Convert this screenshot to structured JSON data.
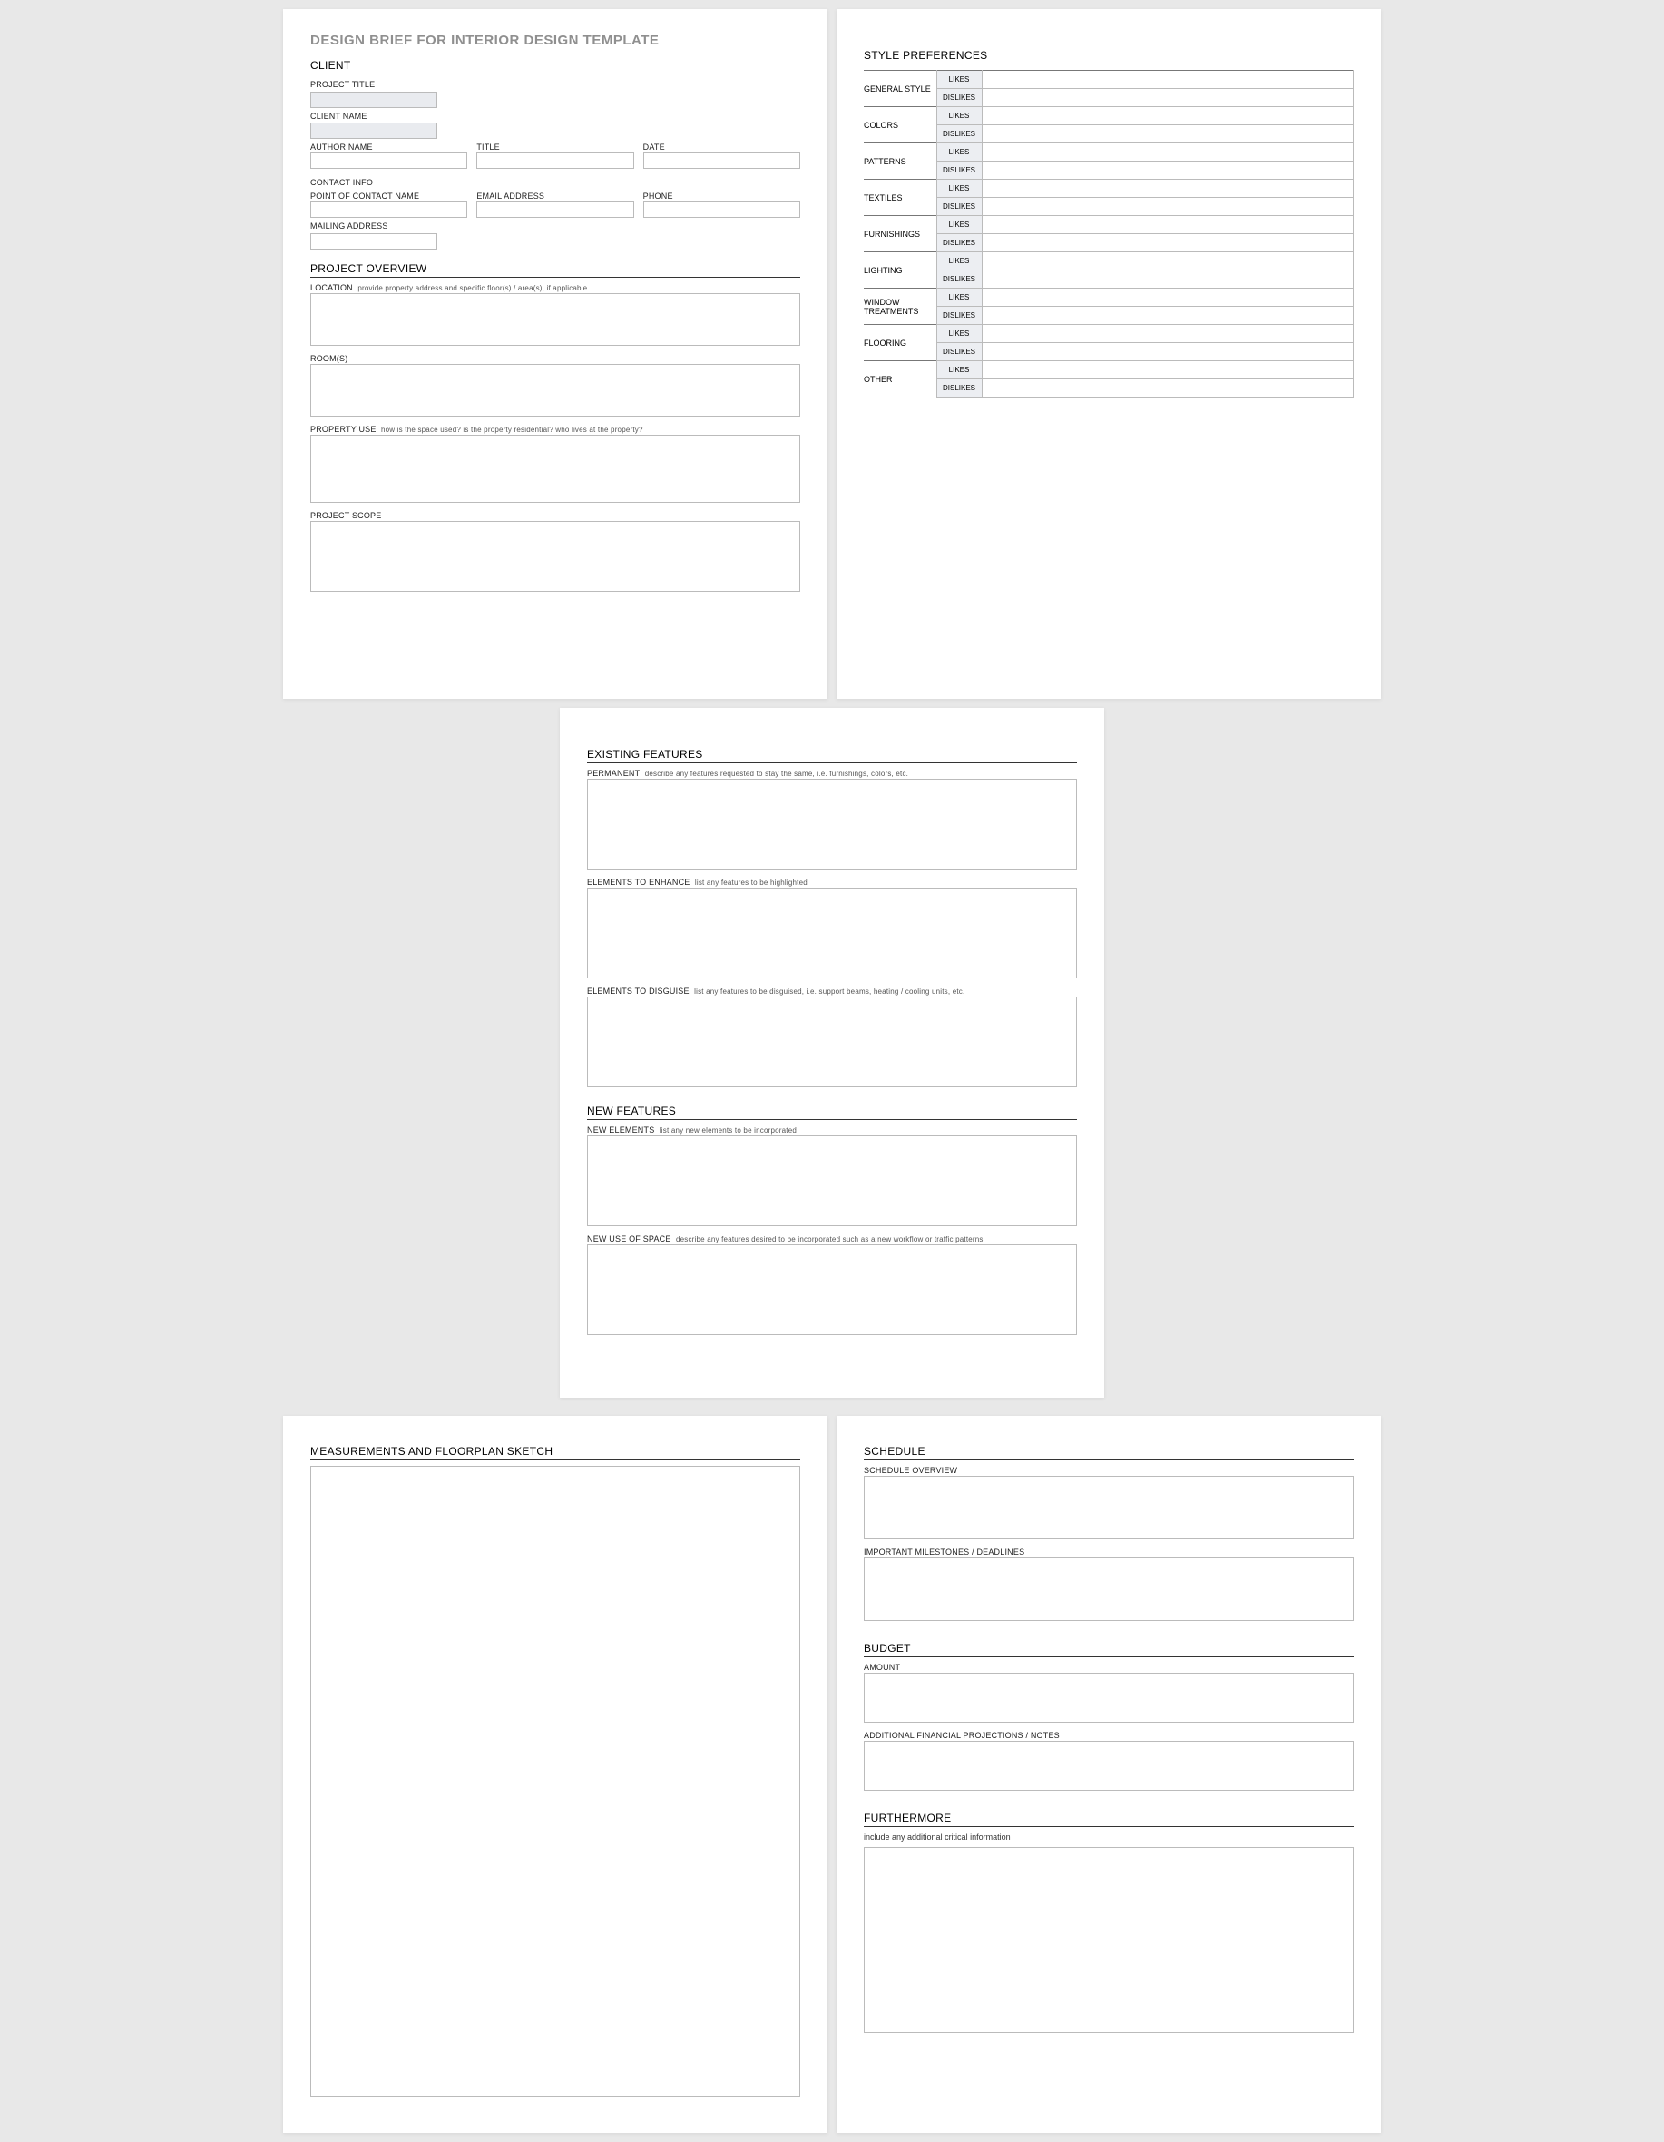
{
  "docTitle": "DESIGN BRIEF FOR INTERIOR DESIGN TEMPLATE",
  "page1": {
    "clientSection": "CLIENT",
    "projectTitle": "PROJECT TITLE",
    "clientName": "CLIENT NAME",
    "authorName": "AUTHOR NAME",
    "title": "TITLE",
    "date": "DATE",
    "contactInfo": "CONTACT INFO",
    "pocName": "POINT OF CONTACT NAME",
    "emailAddress": "EMAIL ADDRESS",
    "phone": "PHONE",
    "mailingAddress": "MAILING ADDRESS",
    "projectOverview": "PROJECT OVERVIEW",
    "location": "LOCATION",
    "locationHint": "provide property address and specific floor(s) / area(s), if applicable",
    "rooms": "ROOM(S)",
    "propertyUse": "PROPERTY USE",
    "propertyUseHint": "how is the space used?  is the property residential? who lives at the property?",
    "projectScope": "PROJECT SCOPE"
  },
  "page2": {
    "stylePrefs": "STYLE PREFERENCES",
    "likes": "LIKES",
    "dislikes": "DISLIKES",
    "cats": {
      "general": "GENERAL STYLE",
      "colors": "COLORS",
      "patterns": "PATTERNS",
      "textiles": "TEXTILES",
      "furnishings": "FURNISHINGS",
      "lighting": "LIGHTING",
      "window": "WINDOW TREATMENTS",
      "flooring": "FLOORING",
      "other": "OTHER"
    }
  },
  "page3": {
    "existing": "EXISTING FEATURES",
    "permanent": "PERMANENT",
    "permanentHint": "describe any features requested to stay the same, i.e. furnishings, colors, etc.",
    "enhance": "ELEMENTS TO ENHANCE",
    "enhanceHint": "list any features to be highlighted",
    "disguise": "ELEMENTS TO DISGUISE",
    "disguiseHint": "list any features to be disguised, i.e. support beams, heating / cooling units, etc.",
    "newFeatures": "NEW FEATURES",
    "newElements": "NEW ELEMENTS",
    "newElementsHint": "list any new elements to be incorporated",
    "newUse": "NEW USE OF SPACE",
    "newUseHint": "describe any features desired to be incorporated such as a new workflow or traffic patterns"
  },
  "page4": {
    "sketch": "MEASUREMENTS AND FLOORPLAN SKETCH"
  },
  "page5": {
    "schedule": "SCHEDULE",
    "overview": "SCHEDULE OVERVIEW",
    "milestones": "IMPORTANT MILESTONES / DEADLINES",
    "budget": "BUDGET",
    "amount": "AMOUNT",
    "addFin": "ADDITIONAL FINANCIAL PROJECTIONS / NOTES",
    "furthermore": "FURTHERMORE",
    "furtherHint": "include any additional critical information"
  }
}
